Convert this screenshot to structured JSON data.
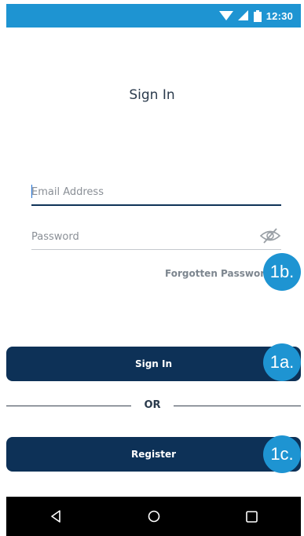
{
  "status_bar": {
    "time": "12:30",
    "icons": [
      "wifi-icon",
      "signal-icon",
      "battery-icon"
    ],
    "background": "#1e94d2"
  },
  "page": {
    "title": "Sign In"
  },
  "form": {
    "email": {
      "placeholder": "Email Address",
      "value": ""
    },
    "password": {
      "placeholder": "Password",
      "value": "",
      "toggle_icon": "eye-slash-icon"
    },
    "forgot_label": "Forgotten Password"
  },
  "actions": {
    "signin_label": "Sign In",
    "or_label": "OR",
    "register_label": "Register",
    "button_color": "#0d3157"
  },
  "callouts": {
    "one_a": "1a.",
    "one_b": "1b.",
    "one_c": "1c."
  },
  "nav_bar": {
    "icons": [
      "back-icon",
      "home-icon",
      "recents-icon"
    ]
  }
}
